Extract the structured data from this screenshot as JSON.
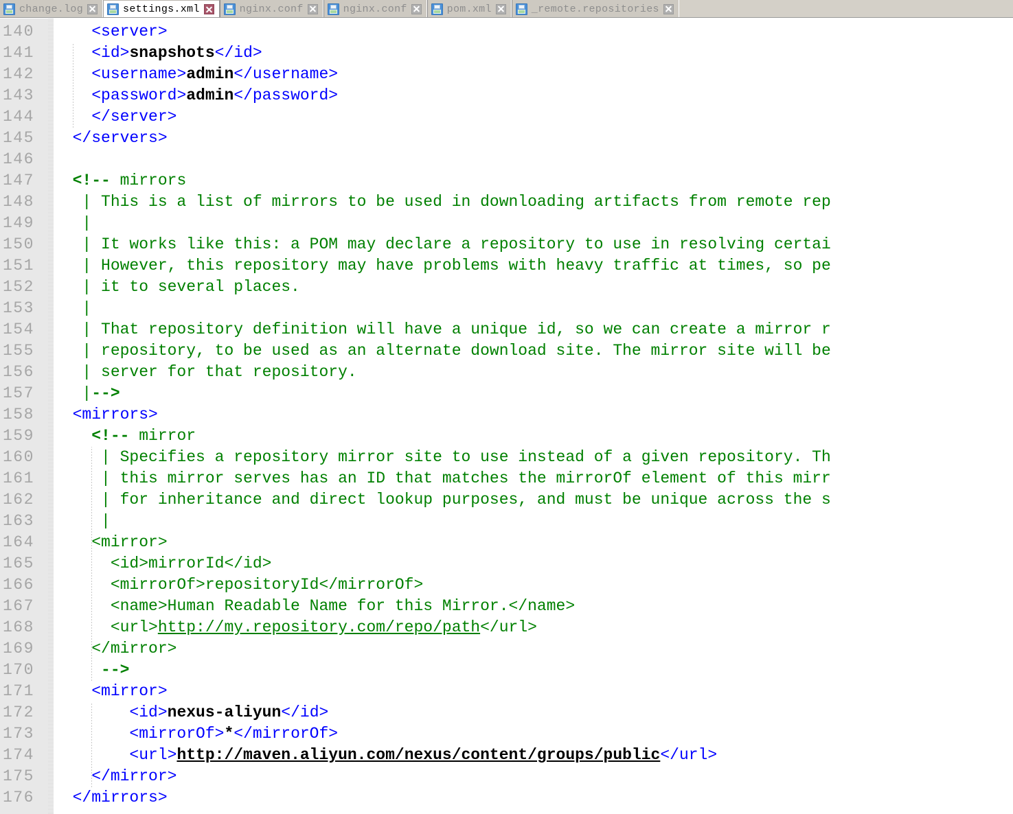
{
  "window": {
    "title": "settings.xml"
  },
  "tabbar": {
    "tabs": [
      {
        "label": "change.log",
        "active": false,
        "icon": "floppy-disk-icon",
        "close_icon": "close-icon"
      },
      {
        "label": "settings.xml",
        "active": true,
        "icon": "floppy-disk-icon",
        "close_icon": "close-icon"
      },
      {
        "label": "nginx.conf",
        "active": false,
        "icon": "floppy-disk-icon",
        "close_icon": "close-icon"
      },
      {
        "label": "nginx.conf",
        "active": false,
        "icon": "floppy-disk-icon",
        "close_icon": "close-icon"
      },
      {
        "label": "pom.xml",
        "active": false,
        "icon": "floppy-disk-icon",
        "close_icon": "close-icon"
      },
      {
        "label": "_remote.repositories",
        "active": false,
        "icon": "floppy-disk-icon",
        "close_icon": "close-icon"
      }
    ]
  },
  "colors": {
    "tag": "#0000ff",
    "text": "#000000",
    "comment": "#008000",
    "gutter_bg": "#e8e8e8",
    "lineno": "#a6a6a6",
    "tabbar_bg": "#d4d0c8",
    "active_tab_bg": "#ffffff",
    "close_active": "#a8566a"
  },
  "editor": {
    "first_line": 140,
    "last_line": 176,
    "line_height": 31,
    "font_size": 23,
    "lines": [
      {
        "n": 140,
        "segs": [
          {
            "t": "    ",
            "c": "tg"
          },
          {
            "t": "<server>",
            "c": "tg"
          }
        ]
      },
      {
        "n": 141,
        "segs": [
          {
            "t": "    ",
            "c": "tg"
          },
          {
            "t": "<id>",
            "c": "tg"
          },
          {
            "t": "snapshots",
            "c": "tx"
          },
          {
            "t": "</id>",
            "c": "tg"
          }
        ]
      },
      {
        "n": 142,
        "segs": [
          {
            "t": "    ",
            "c": "tg"
          },
          {
            "t": "<username>",
            "c": "tg"
          },
          {
            "t": "admin",
            "c": "tx"
          },
          {
            "t": "</username>",
            "c": "tg"
          }
        ]
      },
      {
        "n": 143,
        "segs": [
          {
            "t": "    ",
            "c": "tg"
          },
          {
            "t": "<password>",
            "c": "tg"
          },
          {
            "t": "admin",
            "c": "tx"
          },
          {
            "t": "</password>",
            "c": "tg"
          }
        ]
      },
      {
        "n": 144,
        "segs": [
          {
            "t": "    ",
            "c": "tg"
          },
          {
            "t": "</server>",
            "c": "tg"
          }
        ]
      },
      {
        "n": 145,
        "segs": [
          {
            "t": "  ",
            "c": "tg"
          },
          {
            "t": "</servers>",
            "c": "tg"
          }
        ]
      },
      {
        "n": 146,
        "segs": []
      },
      {
        "n": 147,
        "segs": [
          {
            "t": "  ",
            "c": "cm"
          },
          {
            "t": "<!--",
            "c": "cmb"
          },
          {
            "t": " mirrors",
            "c": "cm"
          }
        ]
      },
      {
        "n": 148,
        "segs": [
          {
            "t": "   | This is a list of mirrors to be used in downloading artifacts from remote rep",
            "c": "cm"
          }
        ]
      },
      {
        "n": 149,
        "segs": [
          {
            "t": "   |",
            "c": "cm"
          }
        ]
      },
      {
        "n": 150,
        "segs": [
          {
            "t": "   | It works like this: a POM may declare a repository to use in resolving certai",
            "c": "cm"
          }
        ]
      },
      {
        "n": 151,
        "segs": [
          {
            "t": "   | However, this repository may have problems with heavy traffic at times, so pe",
            "c": "cm"
          }
        ]
      },
      {
        "n": 152,
        "segs": [
          {
            "t": "   | it to several places.",
            "c": "cm"
          }
        ]
      },
      {
        "n": 153,
        "segs": [
          {
            "t": "   |",
            "c": "cm"
          }
        ]
      },
      {
        "n": 154,
        "segs": [
          {
            "t": "   | That repository definition will have a unique id, so we can create a mirror r",
            "c": "cm"
          }
        ]
      },
      {
        "n": 155,
        "segs": [
          {
            "t": "   | repository, to be used as an alternate download site. The mirror site will be",
            "c": "cm"
          }
        ]
      },
      {
        "n": 156,
        "segs": [
          {
            "t": "   | server for that repository.",
            "c": "cm"
          }
        ]
      },
      {
        "n": 157,
        "segs": [
          {
            "t": "   |",
            "c": "cm"
          },
          {
            "t": "-->",
            "c": "cmb"
          }
        ]
      },
      {
        "n": 158,
        "segs": [
          {
            "t": "  ",
            "c": "tg"
          },
          {
            "t": "<mirrors>",
            "c": "tg"
          }
        ]
      },
      {
        "n": 159,
        "segs": [
          {
            "t": "    ",
            "c": "cm"
          },
          {
            "t": "<!--",
            "c": "cmb"
          },
          {
            "t": " mirror",
            "c": "cm"
          }
        ]
      },
      {
        "n": 160,
        "segs": [
          {
            "t": "     | Specifies a repository mirror site to use instead of a given repository. Th",
            "c": "cm"
          }
        ]
      },
      {
        "n": 161,
        "segs": [
          {
            "t": "     | this mirror serves has an ID that matches the mirrorOf element of this mirr",
            "c": "cm"
          }
        ]
      },
      {
        "n": 162,
        "segs": [
          {
            "t": "     | for inheritance and direct lookup purposes, and must be unique across the s",
            "c": "cm"
          }
        ]
      },
      {
        "n": 163,
        "segs": [
          {
            "t": "     |",
            "c": "cm"
          }
        ]
      },
      {
        "n": 164,
        "segs": [
          {
            "t": "    <mirror>",
            "c": "cm"
          }
        ]
      },
      {
        "n": 165,
        "segs": [
          {
            "t": "      <id>mirrorId</id>",
            "c": "cm"
          }
        ]
      },
      {
        "n": 166,
        "segs": [
          {
            "t": "      <mirrorOf>repositoryId</mirrorOf>",
            "c": "cm"
          }
        ]
      },
      {
        "n": 167,
        "segs": [
          {
            "t": "      <name>Human Readable Name for this Mirror.</name>",
            "c": "cm"
          }
        ]
      },
      {
        "n": 168,
        "segs": [
          {
            "t": "      <url>",
            "c": "cm"
          },
          {
            "t": "http://my.repository.com/repo/path",
            "c": "lnk"
          },
          {
            "t": "</url>",
            "c": "cm"
          }
        ]
      },
      {
        "n": 169,
        "segs": [
          {
            "t": "    </mirror>",
            "c": "cm"
          }
        ]
      },
      {
        "n": 170,
        "segs": [
          {
            "t": "     ",
            "c": "cm"
          },
          {
            "t": "-->",
            "c": "cmb"
          }
        ]
      },
      {
        "n": 171,
        "segs": [
          {
            "t": "    ",
            "c": "tg"
          },
          {
            "t": "<mirror>",
            "c": "tg"
          }
        ]
      },
      {
        "n": 172,
        "segs": [
          {
            "t": "        ",
            "c": "tg"
          },
          {
            "t": "<id>",
            "c": "tg"
          },
          {
            "t": "nexus-aliyun",
            "c": "tx"
          },
          {
            "t": "</id>",
            "c": "tg"
          }
        ]
      },
      {
        "n": 173,
        "segs": [
          {
            "t": "        ",
            "c": "tg"
          },
          {
            "t": "<mirrorOf>",
            "c": "tg"
          },
          {
            "t": "*",
            "c": "tx"
          },
          {
            "t": "</mirrorOf>",
            "c": "tg"
          }
        ]
      },
      {
        "n": 174,
        "segs": [
          {
            "t": "        ",
            "c": "tg"
          },
          {
            "t": "<url>",
            "c": "tg"
          },
          {
            "t": "http://maven.aliyun.com/nexus/content/groups/public",
            "c": "lnkb"
          },
          {
            "t": "</url>",
            "c": "tg"
          }
        ]
      },
      {
        "n": 175,
        "segs": [
          {
            "t": "    ",
            "c": "tg"
          },
          {
            "t": "</mirror>",
            "c": "tg"
          }
        ]
      },
      {
        "n": 176,
        "segs": [
          {
            "t": "  ",
            "c": "tg"
          },
          {
            "t": "</mirrors>",
            "c": "tg"
          }
        ]
      }
    ],
    "fold_markers": [
      {
        "line": 140,
        "type": "box"
      },
      {
        "line": 144,
        "type": "tick"
      },
      {
        "line": 145,
        "type": "tick"
      },
      {
        "line": 147,
        "type": "box"
      },
      {
        "line": 157,
        "type": "tick"
      },
      {
        "line": 158,
        "type": "box"
      },
      {
        "line": 159,
        "type": "box"
      },
      {
        "line": 171,
        "type": "box"
      },
      {
        "line": 175,
        "type": "tick"
      },
      {
        "line": 176,
        "type": "tick"
      }
    ],
    "indent_guides": [
      {
        "col": 2,
        "from_line": 141,
        "to_line": 144
      },
      {
        "col": 4,
        "from_line": 160,
        "to_line": 170
      },
      {
        "col": 4,
        "from_line": 172,
        "to_line": 175
      }
    ]
  }
}
